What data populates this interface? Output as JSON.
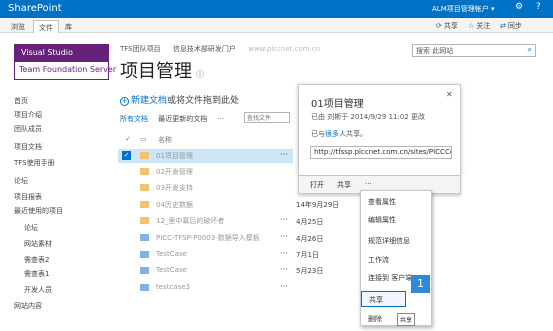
{
  "topbar": {
    "brand": "SharePoint",
    "account": "ALM项目管理帐户 ▾",
    "icons": [
      "gear-icon",
      "help-icon"
    ]
  },
  "ribbon": {
    "tabs": [
      "浏览",
      "文件",
      "库"
    ],
    "active_tab": "文件",
    "actions": [
      "共享",
      "关注",
      "同步"
    ]
  },
  "logo": {
    "line1": "Visual Studio",
    "line2": "Team Foundation Server"
  },
  "breadcrumbs": [
    "TFS团队项目",
    "信息技术部研发门户",
    "www.plccnet.com.cn"
  ],
  "page_title": "项目管理",
  "search": {
    "placeholder": "搜索 此网站"
  },
  "nav": {
    "items": [
      "首页",
      "项目介绍",
      "团队成员",
      "项目文档",
      "TFS使用手册",
      "论坛",
      "项目报表",
      "最近使用的项目"
    ],
    "sub_items": [
      "论坛",
      "网站素材",
      "需查表2",
      "需查表1",
      "开发人员"
    ],
    "footer": "网站内容"
  },
  "new_doc": {
    "link": "新建文档",
    "rest": "或将文件拖到此处"
  },
  "views": {
    "all": "所有文档",
    "recent": "最近更新的文档",
    "more": "···",
    "find_placeholder": "查找文件"
  },
  "list": {
    "header_name": "名称",
    "rows": [
      {
        "name": "01项目管理",
        "type": "folder",
        "date": "",
        "selected": true
      },
      {
        "name": "02开发管理",
        "type": "folder",
        "date": "",
        "selected": false
      },
      {
        "name": "03开发支持",
        "type": "folder",
        "date": "",
        "selected": false
      },
      {
        "name": "04历史数据",
        "type": "folder",
        "date": "",
        "selected": false
      },
      {
        "name": "12_里中幕后的破坏者",
        "type": "folder",
        "date": "14年9月29日",
        "selected": false
      },
      {
        "name": "PICC-TFSP-P0003-数据导入模板",
        "type": "doc",
        "date": "4月25日",
        "selected": false
      },
      {
        "name": "TestCase",
        "type": "doc",
        "date": "4月26日",
        "selected": false
      },
      {
        "name": "TestCase",
        "type": "doc",
        "date": "7月1日",
        "selected": false
      },
      {
        "name": "testcase3",
        "type": "doc",
        "date": "5月23日",
        "selected": false
      }
    ]
  },
  "callout": {
    "title": "01项目管理",
    "meta": "已由 刘斯于 2014/9/29 11:02 更改",
    "shared_pre": "已与",
    "shared_link": "很多人",
    "shared_post": "共享。",
    "url": "http://tfssp.plccnet.com.cn/sites/PICCCo",
    "actions": [
      "打开",
      "共享",
      "···"
    ]
  },
  "menu": {
    "items": [
      "查看属性",
      "编辑属性",
      "规范详细信息",
      "工作流",
      "连接到 客户端",
      "共享",
      "删除"
    ],
    "highlighted": "共享",
    "tooltip": "共享"
  },
  "badge": "1",
  "colors": {
    "accent": "#0072c6",
    "brand_purple": "#68217a",
    "selected_row": "#cde6f7"
  }
}
